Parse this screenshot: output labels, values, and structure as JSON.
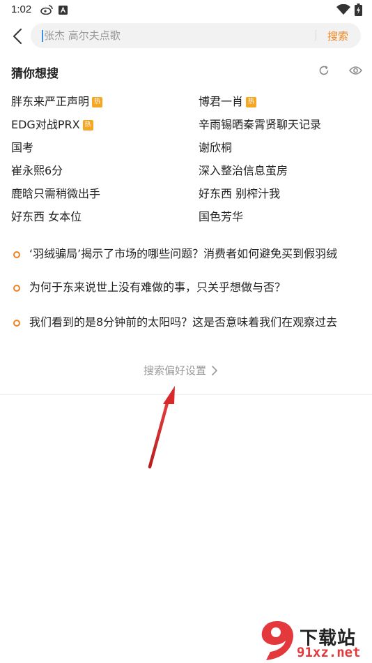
{
  "status_bar": {
    "time": "1:02",
    "left_icons": [
      "weibo-icon",
      "app-a-icon"
    ],
    "right_icons": [
      "wifi-icon",
      "battery-charging-icon"
    ]
  },
  "search": {
    "placeholder": "张杰 高尔夫点歌",
    "submit_label": "搜索"
  },
  "guess": {
    "title": "猜你想搜",
    "items": [
      {
        "label": "胖东来严正声明",
        "hot": true
      },
      {
        "label": "博君一肖",
        "hot": true
      },
      {
        "label": "EDG对战PRX",
        "hot": true
      },
      {
        "label": "辛雨锡晒秦霄贤聊天记录",
        "hot": false
      },
      {
        "label": "国考",
        "hot": false
      },
      {
        "label": "谢欣桐",
        "hot": false
      },
      {
        "label": "崔永熙6分",
        "hot": false
      },
      {
        "label": "深入整治信息茧房",
        "hot": false
      },
      {
        "label": "鹿晗只需稍微出手",
        "hot": false
      },
      {
        "label": "好东西 别榨汁我",
        "hot": false
      },
      {
        "label": "好东西 女本位",
        "hot": false
      },
      {
        "label": "国色芳华",
        "hot": false
      }
    ],
    "hot_badge": "热"
  },
  "topics": [
    "‘羽绒骗局’揭示了市场的哪些问题？消费者如何避免买到假羽绒",
    "为何于东来说世上没有难做的事，只关乎想做与否？",
    "我们看到的是8分钟前的太阳吗？这是否意味着我们在观察过去"
  ],
  "preferences_link": "搜索偏好设置",
  "watermark": {
    "site": "下载站",
    "url": "91xz.net",
    "logo_glyph": "9"
  },
  "colors": {
    "accent": "#f0821e",
    "hot_badge": "#f5a623",
    "annotation_arrow": "#d8282a"
  }
}
